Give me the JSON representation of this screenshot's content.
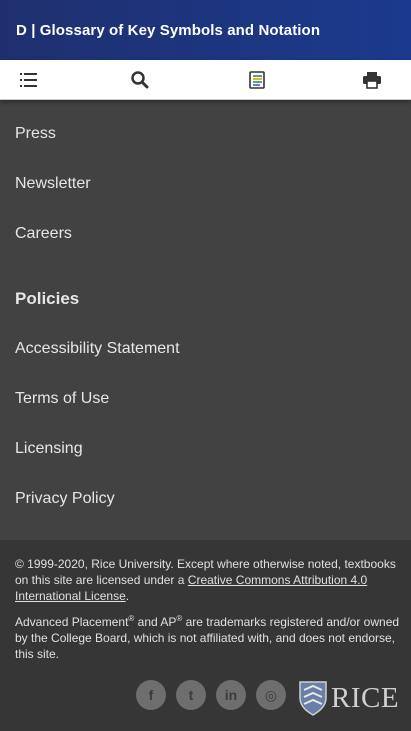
{
  "header": {
    "title": "D | Glossary of Key Symbols and Notation"
  },
  "toolbar": {
    "toc_icon": "table-of-contents-icon",
    "search_icon": "search-icon",
    "highlights_icon": "highlights-notebook-icon",
    "print_icon": "print-icon"
  },
  "links_top": [
    "Press",
    "Newsletter",
    "Careers"
  ],
  "policies": {
    "heading": "Policies",
    "items": [
      "Accessibility Statement",
      "Terms of Use",
      "Licensing",
      "Privacy Policy"
    ]
  },
  "footer": {
    "copyright_text": "© 1999-2020, Rice University. Except where otherwise noted, textbooks on this site are licensed under a",
    "license_link": "Creative Commons Attribution 4.0 International License",
    "period": ".",
    "ap_part1": "Advanced Placement",
    "reg_mark": "®",
    "ap_part2": " and AP",
    "ap_part3": " are trademarks registered and/or owned by the College Board, which is not affiliated with, and does not endorse, this site.",
    "social": [
      {
        "name": "facebook-icon",
        "glyph": "f"
      },
      {
        "name": "twitter-icon",
        "glyph": "t"
      },
      {
        "name": "linkedin-icon",
        "glyph": "in"
      },
      {
        "name": "instagram-icon",
        "glyph": "◎"
      }
    ],
    "rice_logo": "RICE"
  },
  "colors": {
    "header_bg": "#1b3a8e",
    "body_bg": "#424242",
    "footer_bg": "#363636",
    "text": "#e6e6e6"
  }
}
